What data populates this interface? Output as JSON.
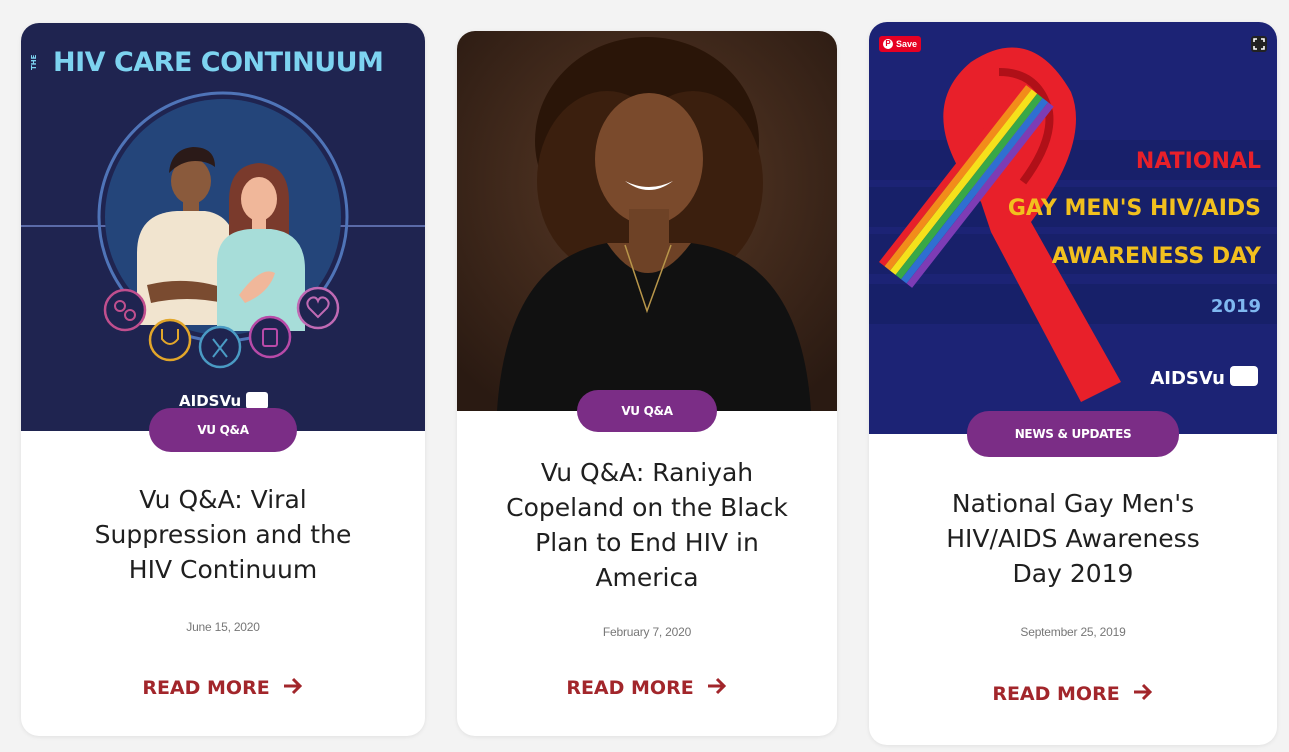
{
  "cards": [
    {
      "image_heading_prefix": "THE",
      "image_heading": "HIV CARE CONTINUUM",
      "image_logo": "AIDSVu",
      "tag": "VU Q&A",
      "title_lines": [
        "Vu Q&A: Viral",
        "Suppression and the",
        "HIV Continuum"
      ],
      "date": "June 15, 2020",
      "read_more": "READ MORE",
      "icons": [
        "pills-icon",
        "stethoscope-icon",
        "ribbon-icon",
        "medicine-bottle-icon",
        "heart-icon"
      ]
    },
    {
      "tag": "VU Q&A",
      "title_lines": [
        "Vu Q&A: Raniyah",
        "Copeland on the Black",
        "Plan to End HIV in",
        "America"
      ],
      "date": "February 7, 2020",
      "read_more": "READ MORE"
    },
    {
      "save_label": "Save",
      "image_lines": [
        "NATIONAL",
        "GAY MEN'S HIV/AIDS",
        "AWARENESS DAY",
        "2019"
      ],
      "image_logo": "AIDSVu",
      "tag": "NEWS & UPDATES",
      "title_lines": [
        "National Gay Men's",
        "HIV/AIDS Awareness",
        "Day 2019"
      ],
      "date": "September 25, 2019",
      "read_more": "READ MORE"
    }
  ],
  "colors": {
    "tag_purple": "#7b2d86",
    "read_more_red": "#a2262b",
    "card1_navy": "#1f2450",
    "card1_heading": "#7dd3f0",
    "card3_navy": "#1c2375",
    "card3_red": "#e8202a",
    "card3_gold": "#f2c01e"
  }
}
